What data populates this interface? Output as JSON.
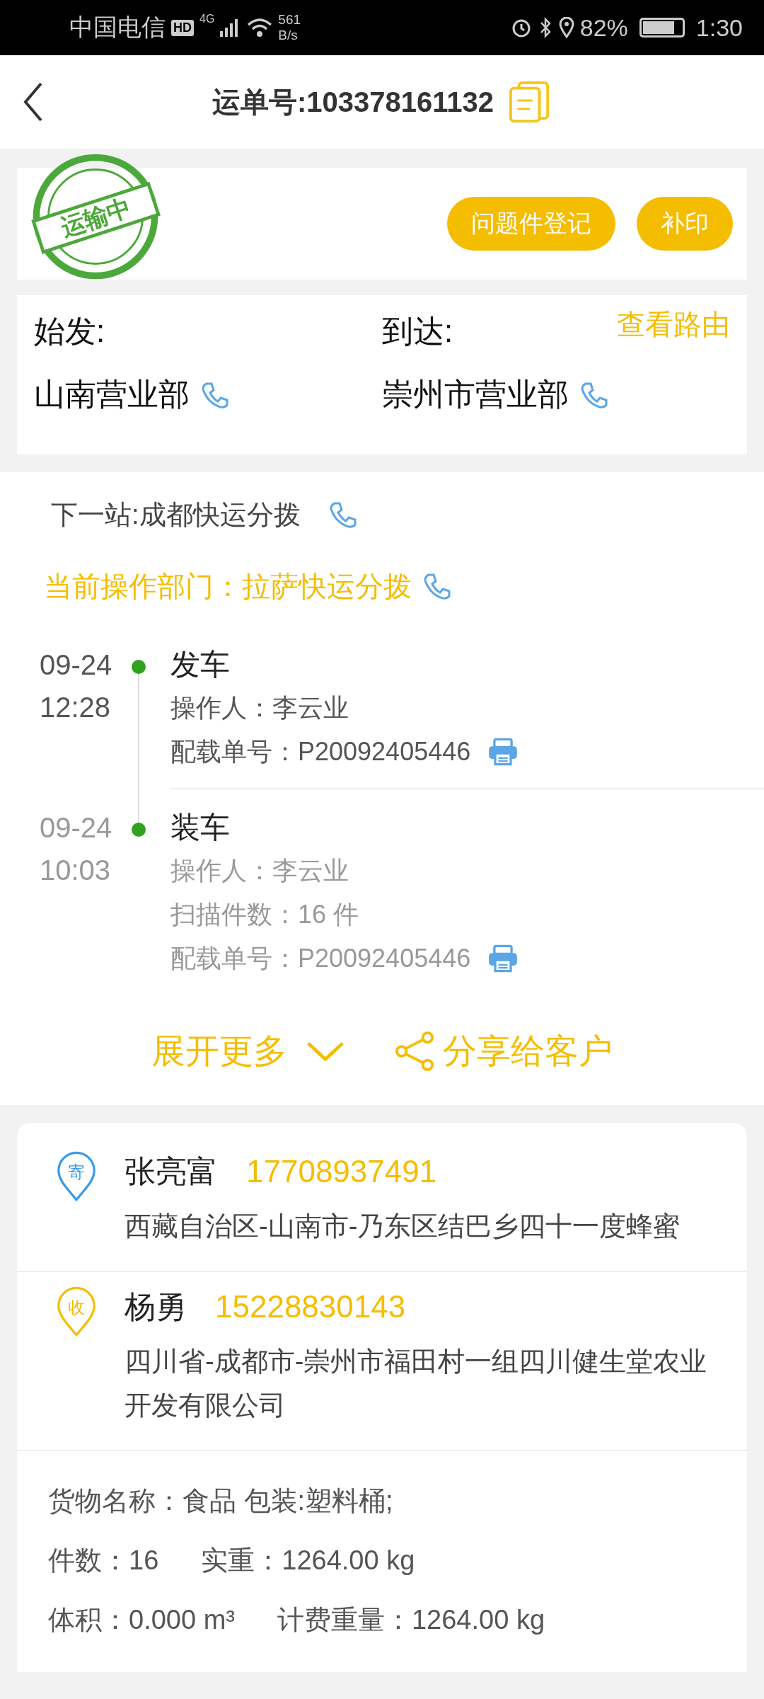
{
  "status_bar": {
    "carrier": "中国电信",
    "hd": "HD",
    "network": "4G",
    "speed": "561",
    "speed_unit": "B/s",
    "battery": "82%",
    "time": "1:30"
  },
  "header": {
    "title": "运单号:103378161132"
  },
  "status_card": {
    "stamp": "运输中",
    "buttons": [
      "问题件登记",
      "补印"
    ]
  },
  "route": {
    "origin_label": "始发:",
    "origin": "山南营业部",
    "dest_label": "到达:",
    "dest": "崇州市营业部",
    "link": "查看路由"
  },
  "next_station": "下一站:成都快运分拨",
  "current_dept": "当前操作部门：拉萨快运分拨",
  "events": [
    {
      "date": "09-24",
      "time": "12:28",
      "title": "发车",
      "current": true,
      "details": [
        {
          "text": "操作人：李云业",
          "printable": false
        },
        {
          "text": "配载单号：P20092405446",
          "printable": true
        }
      ]
    },
    {
      "date": "09-24",
      "time": "10:03",
      "title": "装车",
      "current": false,
      "details": [
        {
          "text": "操作人：李云业",
          "printable": false
        },
        {
          "text": "扫描件数：16 件",
          "printable": false
        },
        {
          "text": "配载单号：P20092405446",
          "printable": true
        }
      ]
    }
  ],
  "actions": {
    "expand": "展开更多",
    "share": "分享给客户"
  },
  "parties": [
    {
      "badge": "寄",
      "color": "#3a9be8",
      "name": "张亮富",
      "phone": "17708937491",
      "address": "西藏自治区-山南市-乃东区结巴乡四十一度蜂蜜"
    },
    {
      "badge": "收",
      "color": "#f5bd00",
      "name": "杨勇",
      "phone": "15228830143",
      "address": "四川省-成都市-崇州市福田村一组四川健生堂农业开发有限公司"
    }
  ],
  "cargo": [
    [
      "货物名称：食品 包装:塑料桶;"
    ],
    [
      "件数：16",
      "实重：1264.00 kg"
    ],
    [
      "体积：0.000 m³",
      "计费重量：1264.00 kg"
    ]
  ]
}
